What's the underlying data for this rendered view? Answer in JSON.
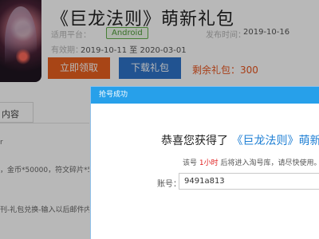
{
  "game": {
    "title": "《巨龙法则》萌新礼包",
    "platform_label": "适用平台：",
    "platform_value": "Android",
    "publish_label": "发布时间：",
    "publish_date": "2019-10-16",
    "validity_label": "有效期：",
    "validity_value": "2019-10-11 至 2020-03-01"
  },
  "actions": {
    "claim_label": "立即领取",
    "download_label": "下载礼包",
    "remaining_text": "剩余礼包：300"
  },
  "tabs": {
    "content_label": "内容"
  },
  "side": {
    "line1": "r",
    "line2": "，金币*50000，符文碎片*5",
    "line3": "刊-礼包兑换-输入以后邮件内"
  },
  "modal": {
    "header": "抢号成功",
    "congrats_prefix": "恭喜您获得了",
    "congrats_game": "《巨龙法则》萌新",
    "notice_prefix": "该号",
    "notice_time": "1小时",
    "notice_suffix": "后将进入淘号库，请尽快使用。",
    "code_label": "账号：",
    "code_value": "9491a813"
  },
  "colors": {
    "claim_button": "#e9601f",
    "download_button": "#2f73c9",
    "remaining": "#e8541d",
    "modal_header": "#27a0ea",
    "highlight": "#1e7fd4",
    "platform_tag": "#4b9a36"
  }
}
